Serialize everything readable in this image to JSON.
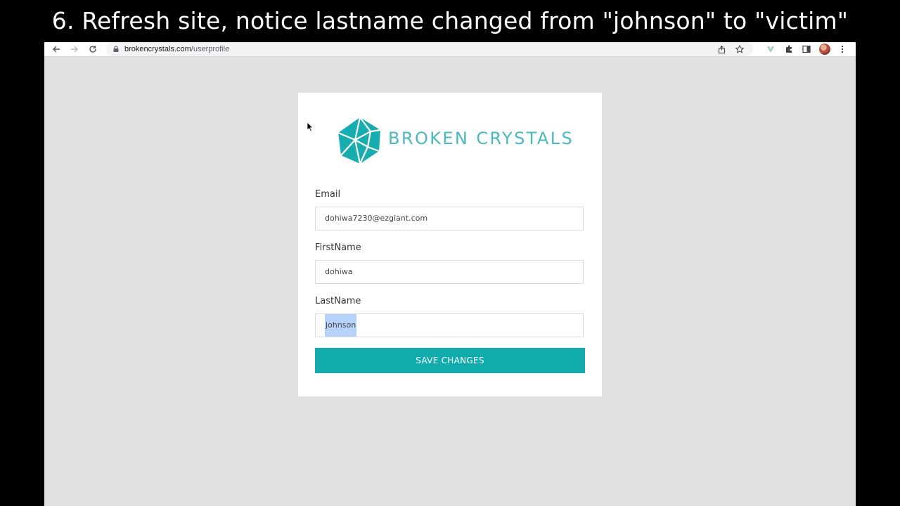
{
  "caption": "6. Refresh site, notice lastname changed from \"johnson\" to \"victim\"",
  "browser": {
    "url_host": "brokencrystals.com",
    "url_path": "/userprofile"
  },
  "logo": {
    "text": "BROKEN CRYSTALS",
    "color": "#4bb8c0"
  },
  "form": {
    "email_label": "Email",
    "email_value": "dohiwa7230@ezgiant.com",
    "firstname_label": "FirstName",
    "firstname_value": "dohiwa",
    "lastname_label": "LastName",
    "lastname_value": "johnson",
    "save_label": "SAVE CHANGES"
  },
  "icons": {
    "back": "back-arrow-icon",
    "forward": "forward-arrow-icon",
    "reload": "reload-icon",
    "lock": "lock-icon",
    "share": "share-icon",
    "bookmark": "star-icon",
    "extension": "puzzle-icon",
    "sidepanel": "side-panel-icon",
    "menu": "kebab-menu-icon"
  },
  "colors": {
    "accent": "#10acad",
    "background": "#e1e1e1"
  }
}
